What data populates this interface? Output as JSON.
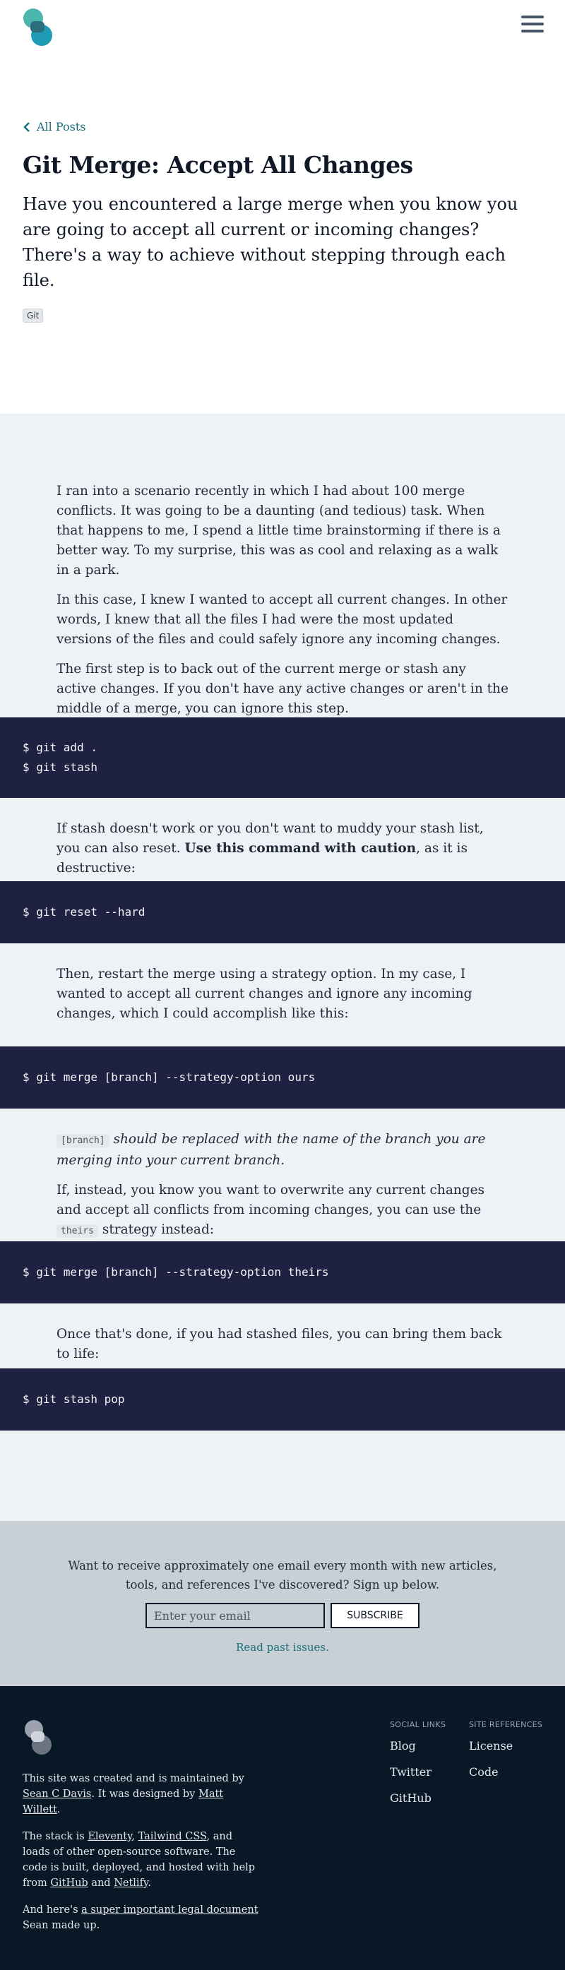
{
  "header": {
    "logo_icon": "site-logo-icon",
    "menu_icon": "hamburger-menu-icon"
  },
  "hero": {
    "back_label": "All Posts",
    "title": "Git Merge: Accept All Changes",
    "intro": "Have you encountered a large merge when you know you are going to accept all current or incoming changes? There's a way to achieve without stepping through each file.",
    "tag": "Git"
  },
  "article": {
    "p1": "I ran into a scenario recently in which I had about 100 merge conflicts. It was going to be a daunting (and tedious) task. When that happens to me, I spend a little time brainstorming if there is a better way. To my surprise, this was as cool and relaxing as a walk in a park.",
    "p2": "In this case, I knew I wanted to accept all current changes. In other words, I knew that all the files I had were the most updated versions of the files and could safely ignore any incoming changes.",
    "p3": "The first step is to back out of the current merge or stash any active changes. If you don't have any active changes or aren't in the middle of a merge, you can ignore this step.",
    "code1": [
      "$ git add .",
      "$ git stash"
    ],
    "p4_before": "If stash doesn't work or you don't want to muddy your stash list, you can also reset. ",
    "p4_bold": "Use this command with caution",
    "p4_after": ", as it is destructive:",
    "code2": [
      "$ git reset --hard"
    ],
    "p5": "Then, restart the merge using a strategy option. In my case, I wanted to accept all current changes and ignore any incoming changes, which I could accomplish like this:",
    "code3": [
      "$ git merge [branch] --strategy-option ours"
    ],
    "p6_code": "[branch]",
    "p6_text": " should be replaced with the name of the branch you are merging into your current branch.",
    "p7_before": "If, instead, you know you want to overwrite any current changes and accept all conflicts from incoming changes, you can use the ",
    "p7_code": "theirs",
    "p7_after": " strategy instead:",
    "code4": [
      "$ git merge [branch] --strategy-option theirs"
    ],
    "p8": "Once that's done, if you had stashed files, you can bring them back to life:",
    "code5": [
      "$ git stash pop"
    ]
  },
  "newsletter": {
    "text": "Want to receive approximately one email every month with new articles, tools, and references I've discovered? Sign up below.",
    "email_placeholder": "Enter your email",
    "subscribe_label": "SUBSCRIBE",
    "past_issues_label": "Read past issues."
  },
  "footer": {
    "logo_icon": "footer-logo-icon",
    "created_before": "This site was created and is maintained by ",
    "created_author": "Sean C Davis",
    "created_mid": ". It was designed by ",
    "created_designer": "Matt Willett",
    "created_after": ".",
    "stack_before": "The stack is ",
    "stack_eleventy": "Eleventy",
    "stack_comma": ", ",
    "stack_tailwind": "Tailwind CSS",
    "stack_mid": ", and loads of other open-source software. The code is built, deployed, and hosted with help from ",
    "stack_github": "GitHub",
    "stack_and": " and ",
    "stack_netlify": "Netlify",
    "stack_after": ".",
    "legal_before": "And here's ",
    "legal_link": "a super important legal document",
    "legal_after": " Sean made up.",
    "social_heading": "SOCIAL LINKS",
    "social_links": [
      "Blog",
      "Twitter",
      "GitHub"
    ],
    "ref_heading": "SITE REFERENCES",
    "ref_links": [
      "License",
      "Code"
    ]
  },
  "colors": {
    "accent": "#1a6e7a",
    "article_bg": "#eef1f6",
    "code_bg": "#1f2142",
    "newsletter_bg": "#c8d0d6",
    "footer_bg": "#081827"
  }
}
